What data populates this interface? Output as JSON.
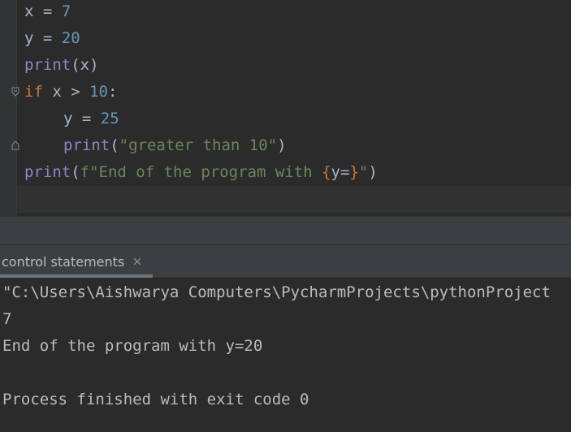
{
  "editor": {
    "lines": [
      {
        "segments": [
          {
            "t": "x = "
          },
          {
            "t": "7",
            "c": "num"
          }
        ]
      },
      {
        "segments": [
          {
            "t": "y = "
          },
          {
            "t": "20",
            "c": "num"
          }
        ]
      },
      {
        "segments": [
          {
            "t": "print",
            "c": "builtin"
          },
          {
            "t": "(x)"
          }
        ]
      },
      {
        "segments": [
          {
            "t": "if",
            "c": "kw"
          },
          {
            "t": " x > "
          },
          {
            "t": "10",
            "c": "num"
          },
          {
            "t": ":"
          }
        ]
      },
      {
        "segments": [
          {
            "t": "y = "
          },
          {
            "t": "25",
            "c": "num"
          }
        ]
      },
      {
        "segments": [
          {
            "t": "print",
            "c": "builtin"
          },
          {
            "t": "("
          },
          {
            "t": "\"greater than 10\"",
            "c": "str"
          },
          {
            "t": ")"
          }
        ]
      },
      {
        "segments": [
          {
            "t": "print",
            "c": "builtin"
          },
          {
            "t": "("
          },
          {
            "t": "f\"End of the program with ",
            "c": "str"
          },
          {
            "t": "{",
            "c": "brace"
          },
          {
            "t": "y="
          },
          {
            "t": "}",
            "c": "brace"
          },
          {
            "t": "\"",
            "c": "str"
          },
          {
            "t": ")"
          }
        ]
      }
    ]
  },
  "run_panel": {
    "tab_label": "control statements",
    "console_lines": [
      "\"C:\\Users\\Aishwarya Computers\\PycharmProjects\\pythonProject",
      "7",
      "End of the program with y=20",
      "",
      "Process finished with exit code 0"
    ]
  },
  "colors": {
    "background": "#2b2b2b",
    "keyword": "#cc7832",
    "number": "#6897bb",
    "string": "#6a8759",
    "builtin": "#8888c6",
    "default_text": "#a9b7c6",
    "console_text": "#bbbbbb"
  }
}
